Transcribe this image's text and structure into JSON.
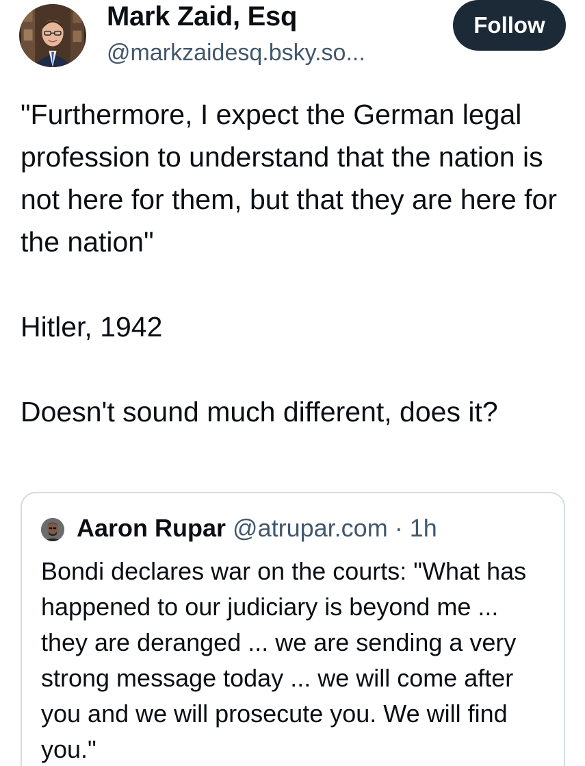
{
  "post": {
    "author_name": "Mark Zaid, Esq",
    "author_handle": "@markzaidesq.bsky.so...",
    "follow_label": "Follow",
    "paragraphs": [
      "\"Furthermore, I expect the German legal profession to understand that the nation is not here for them, but that they are here for the nation\"",
      "Hitler, 1942",
      "Doesn't sound much different, does it?"
    ]
  },
  "quote": {
    "author_name": "Aaron Rupar",
    "author_handle": "@atrupar.com",
    "separator": "·",
    "time": "1h",
    "text": "Bondi declares war on the courts: \"What has happened to our judiciary is beyond me ... they are deranged ... we are sending a very strong message today ... we will come after you and we will prosecute you. We will find you.\""
  },
  "colors": {
    "follow_button_bg": "#1c2a38",
    "secondary_text": "#42576c",
    "card_border": "#d4dbe2"
  },
  "icons": {
    "author_avatar": "profile-photo",
    "quote_avatar": "profile-photo"
  }
}
